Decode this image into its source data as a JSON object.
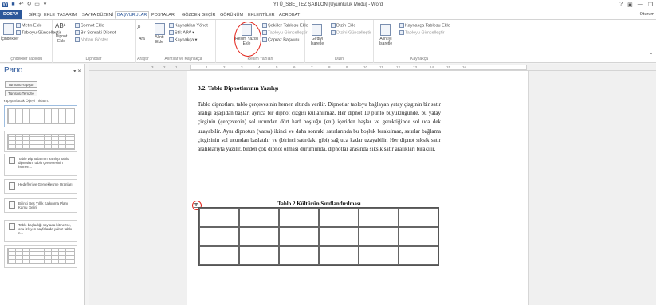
{
  "window": {
    "title": "YTÜ_SBE_TEZ ŞABLON [Uyumluluk Modu] - Word",
    "controls": [
      "?",
      "▣",
      "—",
      "❐"
    ],
    "signin": "Oturum"
  },
  "tabs": [
    "DOSYA",
    "GİRİŞ",
    "EKLE",
    "TASARIM",
    "SAYFA DÜZENİ",
    "BAŞVURULAR",
    "POSTALAR",
    "GÖZDEN GEÇİR",
    "GÖRÜNÜM",
    "EKLENTİLER",
    "ACROBAT"
  ],
  "active_tab": "BAŞVURULAR",
  "ribbon": {
    "toc": {
      "big": "İçindekiler",
      "add": "Metin Ekle",
      "update": "Tabloyu Güncelleştir",
      "label": "İçindekiler Tablosu"
    },
    "footnotes": {
      "big": "Dipnot Ekle",
      "endnote": "Sonnot Ekle",
      "next": "Bir Sonraki Dipnot",
      "show": "Notları Göster",
      "label": "Dipnotlar"
    },
    "research": {
      "big": "Ara",
      "label": "Araştır"
    },
    "citations": {
      "big": "Alıntı Ekle",
      "manage": "Kaynakları Yönet",
      "style": "Stil: APA",
      "bib": "Kaynakça",
      "label": "Alıntılar ve Kaynakça"
    },
    "captions": {
      "big": "Resim Yazısı Ekle",
      "tof": "Şekiller Tablosu Ekle",
      "update": "Tabloyu Güncelleştir",
      "cross": "Çapraz Başvuru",
      "label": "Resim Yazıları"
    },
    "index": {
      "big": "Girdiyi İşaretle",
      "insert": "Dizin Ekle",
      "update": "Dizini Güncelleştir",
      "label": "Dizin"
    },
    "authorities": {
      "big": "Alıntıyı İşaretle",
      "insert": "Kaynakça Tablosu Ekle",
      "update": "Tabloyu Güncelleştir",
      "label": "Kaynakça"
    }
  },
  "pane": {
    "title": "Pano",
    "close": "▾ ✕",
    "paste_all": "Tümünü Yapıştır",
    "clear_all": "Tümünü Temizle",
    "hint": "Yapıştırılacak Öğeyi Tıklatın:",
    "items": [
      "",
      "",
      "Tablo Dipnotlarının Yazılışı Tablo dipnotları, tablo çerçevesinin hemen...",
      "Hedefleri ve Gerçekleşme Oranları",
      "Birinci Beş Yıllık Kalkınma Planı Kamu Geliri",
      "Tablo başladığı sayfada bitmezse, onu izleyen sayfalarda yalnız tablo n...",
      ""
    ]
  },
  "ruler": {
    "ticks": [
      "3",
      "2",
      "1",
      "1",
      "2",
      "3",
      "4",
      "5",
      "6",
      "7",
      "8",
      "9",
      "10",
      "11",
      "12",
      "13",
      "14",
      "15",
      "16"
    ]
  },
  "doc": {
    "heading": "3.2. Tablo Dipnotlarının Yazılışı",
    "paragraph": "Tablo dipnotları, tablo çerçevesinin hemen altında verilir. Dipnotlar tabloyu bağlayan yatay çizginin bir satır aralığı aşağıdan başlar; ayrıca bir dipnot çizgisi kullanılmaz. Her dipnot 10 punto büyüklüğünde, bu yatay çizginin (çerçevenin) sol ucundan dört harf boşluğu (ení) içeriden başlar ve gerektiğinde sol uca dek uzayabilir. Aynı dipnotun (varsa) ikinci ve daha sonraki satırlarında bu boşluk bırakılmaz, satırlar bağlama çizgisinin sol ucundan başlatılır ve (birinci satırdaki gibi) sağ uca kadar uzayabilir. Her dipnot sıksık satır aralıklarıyla yazılır, birden çok dipnot olması durumunda, dipnotlar arasında sıksık satır aralıkları bırakılır.",
    "table_caption": "Tablo 2 Kültürün Sınıflandırılması"
  }
}
